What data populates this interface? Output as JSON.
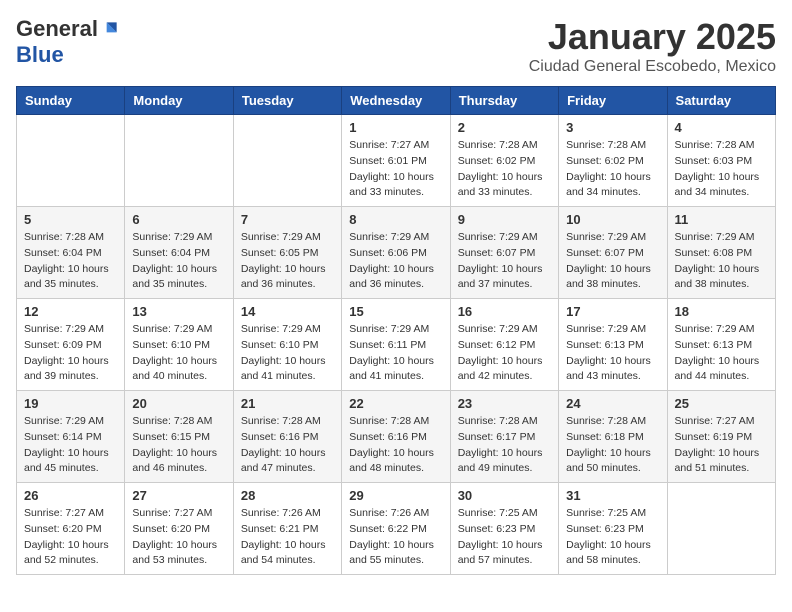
{
  "header": {
    "logo_general": "General",
    "logo_blue": "Blue",
    "month_title": "January 2025",
    "city_title": "Ciudad General Escobedo, Mexico"
  },
  "days_of_week": [
    "Sunday",
    "Monday",
    "Tuesday",
    "Wednesday",
    "Thursday",
    "Friday",
    "Saturday"
  ],
  "weeks": [
    [
      {
        "day": "",
        "info": ""
      },
      {
        "day": "",
        "info": ""
      },
      {
        "day": "",
        "info": ""
      },
      {
        "day": "1",
        "info": "Sunrise: 7:27 AM\nSunset: 6:01 PM\nDaylight: 10 hours\nand 33 minutes."
      },
      {
        "day": "2",
        "info": "Sunrise: 7:28 AM\nSunset: 6:02 PM\nDaylight: 10 hours\nand 33 minutes."
      },
      {
        "day": "3",
        "info": "Sunrise: 7:28 AM\nSunset: 6:02 PM\nDaylight: 10 hours\nand 34 minutes."
      },
      {
        "day": "4",
        "info": "Sunrise: 7:28 AM\nSunset: 6:03 PM\nDaylight: 10 hours\nand 34 minutes."
      }
    ],
    [
      {
        "day": "5",
        "info": "Sunrise: 7:28 AM\nSunset: 6:04 PM\nDaylight: 10 hours\nand 35 minutes."
      },
      {
        "day": "6",
        "info": "Sunrise: 7:29 AM\nSunset: 6:04 PM\nDaylight: 10 hours\nand 35 minutes."
      },
      {
        "day": "7",
        "info": "Sunrise: 7:29 AM\nSunset: 6:05 PM\nDaylight: 10 hours\nand 36 minutes."
      },
      {
        "day": "8",
        "info": "Sunrise: 7:29 AM\nSunset: 6:06 PM\nDaylight: 10 hours\nand 36 minutes."
      },
      {
        "day": "9",
        "info": "Sunrise: 7:29 AM\nSunset: 6:07 PM\nDaylight: 10 hours\nand 37 minutes."
      },
      {
        "day": "10",
        "info": "Sunrise: 7:29 AM\nSunset: 6:07 PM\nDaylight: 10 hours\nand 38 minutes."
      },
      {
        "day": "11",
        "info": "Sunrise: 7:29 AM\nSunset: 6:08 PM\nDaylight: 10 hours\nand 38 minutes."
      }
    ],
    [
      {
        "day": "12",
        "info": "Sunrise: 7:29 AM\nSunset: 6:09 PM\nDaylight: 10 hours\nand 39 minutes."
      },
      {
        "day": "13",
        "info": "Sunrise: 7:29 AM\nSunset: 6:10 PM\nDaylight: 10 hours\nand 40 minutes."
      },
      {
        "day": "14",
        "info": "Sunrise: 7:29 AM\nSunset: 6:10 PM\nDaylight: 10 hours\nand 41 minutes."
      },
      {
        "day": "15",
        "info": "Sunrise: 7:29 AM\nSunset: 6:11 PM\nDaylight: 10 hours\nand 41 minutes."
      },
      {
        "day": "16",
        "info": "Sunrise: 7:29 AM\nSunset: 6:12 PM\nDaylight: 10 hours\nand 42 minutes."
      },
      {
        "day": "17",
        "info": "Sunrise: 7:29 AM\nSunset: 6:13 PM\nDaylight: 10 hours\nand 43 minutes."
      },
      {
        "day": "18",
        "info": "Sunrise: 7:29 AM\nSunset: 6:13 PM\nDaylight: 10 hours\nand 44 minutes."
      }
    ],
    [
      {
        "day": "19",
        "info": "Sunrise: 7:29 AM\nSunset: 6:14 PM\nDaylight: 10 hours\nand 45 minutes."
      },
      {
        "day": "20",
        "info": "Sunrise: 7:28 AM\nSunset: 6:15 PM\nDaylight: 10 hours\nand 46 minutes."
      },
      {
        "day": "21",
        "info": "Sunrise: 7:28 AM\nSunset: 6:16 PM\nDaylight: 10 hours\nand 47 minutes."
      },
      {
        "day": "22",
        "info": "Sunrise: 7:28 AM\nSunset: 6:16 PM\nDaylight: 10 hours\nand 48 minutes."
      },
      {
        "day": "23",
        "info": "Sunrise: 7:28 AM\nSunset: 6:17 PM\nDaylight: 10 hours\nand 49 minutes."
      },
      {
        "day": "24",
        "info": "Sunrise: 7:28 AM\nSunset: 6:18 PM\nDaylight: 10 hours\nand 50 minutes."
      },
      {
        "day": "25",
        "info": "Sunrise: 7:27 AM\nSunset: 6:19 PM\nDaylight: 10 hours\nand 51 minutes."
      }
    ],
    [
      {
        "day": "26",
        "info": "Sunrise: 7:27 AM\nSunset: 6:20 PM\nDaylight: 10 hours\nand 52 minutes."
      },
      {
        "day": "27",
        "info": "Sunrise: 7:27 AM\nSunset: 6:20 PM\nDaylight: 10 hours\nand 53 minutes."
      },
      {
        "day": "28",
        "info": "Sunrise: 7:26 AM\nSunset: 6:21 PM\nDaylight: 10 hours\nand 54 minutes."
      },
      {
        "day": "29",
        "info": "Sunrise: 7:26 AM\nSunset: 6:22 PM\nDaylight: 10 hours\nand 55 minutes."
      },
      {
        "day": "30",
        "info": "Sunrise: 7:25 AM\nSunset: 6:23 PM\nDaylight: 10 hours\nand 57 minutes."
      },
      {
        "day": "31",
        "info": "Sunrise: 7:25 AM\nSunset: 6:23 PM\nDaylight: 10 hours\nand 58 minutes."
      },
      {
        "day": "",
        "info": ""
      }
    ]
  ]
}
